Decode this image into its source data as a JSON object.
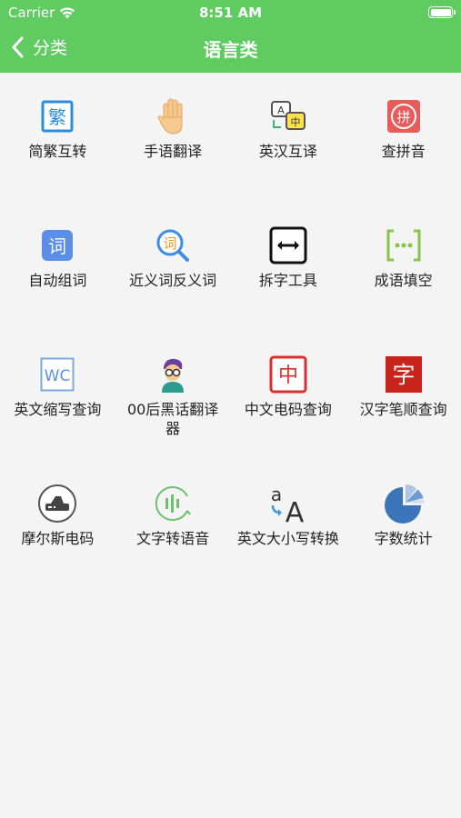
{
  "status_bar": {
    "carrier": "Carrier",
    "time": "8:51 AM"
  },
  "nav": {
    "back_label": "分类",
    "title": "语言类"
  },
  "tools": [
    {
      "label": "简繁互转",
      "icon": "traditional-char-icon"
    },
    {
      "label": "手语翻译",
      "icon": "raised-hand-icon"
    },
    {
      "label": "英汉互译",
      "icon": "translate-icon"
    },
    {
      "label": "查拼音",
      "icon": "pinyin-icon"
    },
    {
      "label": "自动组词",
      "icon": "word-icon"
    },
    {
      "label": "近义词反义词",
      "icon": "word-search-icon"
    },
    {
      "label": "拆字工具",
      "icon": "split-arrows-icon"
    },
    {
      "label": "成语填空",
      "icon": "bracket-dots-icon"
    },
    {
      "label": "英文缩写查询",
      "icon": "wc-abbreviation-icon"
    },
    {
      "label": "00后黑话翻译器",
      "icon": "youth-avatar-icon"
    },
    {
      "label": "中文电码查询",
      "icon": "chinese-code-icon"
    },
    {
      "label": "汉字笔顺查询",
      "icon": "stroke-order-icon"
    },
    {
      "label": "摩尔斯电码",
      "icon": "morse-device-icon"
    },
    {
      "label": "文字转语音",
      "icon": "text-to-speech-icon"
    },
    {
      "label": "英文大小写转换",
      "icon": "letter-case-icon"
    },
    {
      "label": "字数统计",
      "icon": "pie-chart-icon"
    }
  ],
  "icon_text": {
    "fan": "繁",
    "zhong_small": "中",
    "a_small": "A",
    "pin": "拼",
    "ci": "词",
    "dots": "[···]",
    "wc": "WC",
    "zhong": "中",
    "zi": "字",
    "case_small": "a",
    "case_big": "A"
  }
}
